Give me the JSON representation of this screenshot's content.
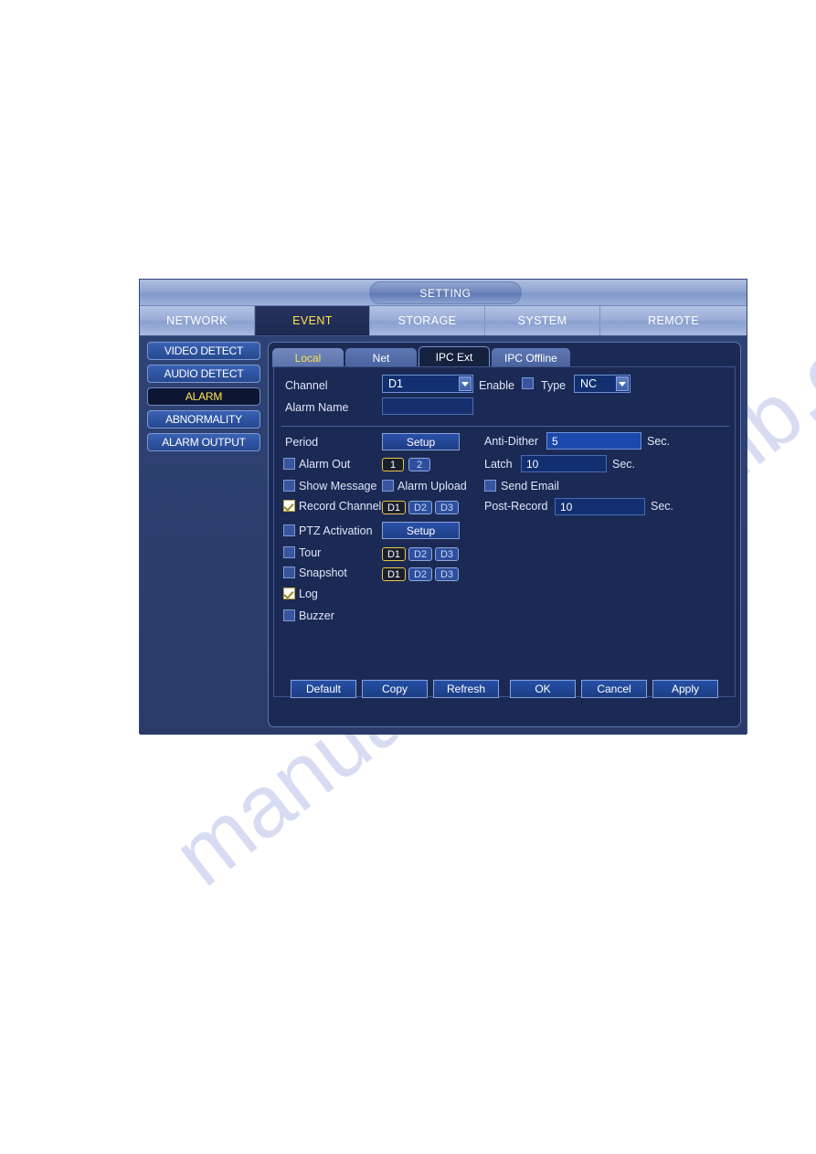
{
  "window": {
    "title": "SETTING"
  },
  "nav": {
    "tabs": [
      {
        "label": "NETWORK",
        "active": false
      },
      {
        "label": "EVENT",
        "active": true
      },
      {
        "label": "STORAGE",
        "active": false
      },
      {
        "label": "SYSTEM",
        "active": false
      },
      {
        "label": "REMOTE",
        "active": false
      }
    ]
  },
  "sidebar": {
    "items": [
      {
        "label": "VIDEO DETECT",
        "active": false
      },
      {
        "label": "AUDIO DETECT",
        "active": false
      },
      {
        "label": "ALARM",
        "active": true
      },
      {
        "label": "ABNORMALITY",
        "active": false
      },
      {
        "label": "ALARM OUTPUT",
        "active": false
      }
    ]
  },
  "subtabs": [
    {
      "label": "Local",
      "state": "highlight"
    },
    {
      "label": "Net",
      "state": "normal"
    },
    {
      "label": "IPC Ext",
      "state": "active"
    },
    {
      "label": "IPC Offline",
      "state": "normal"
    }
  ],
  "form": {
    "channel_label": "Channel",
    "channel_value": "D1",
    "enable_label": "Enable",
    "enable_checked": false,
    "type_label": "Type",
    "type_value": "NC",
    "alarm_name_label": "Alarm Name",
    "alarm_name_value": "",
    "period_label": "Period",
    "period_setup_label": "Setup",
    "anti_dither_label": "Anti-Dither",
    "anti_dither_value": "5",
    "anti_dither_unit": "Sec.",
    "alarm_out_label": "Alarm Out",
    "alarm_out_checked": false,
    "alarm_out_ports": [
      {
        "label": "1",
        "on": true
      },
      {
        "label": "2",
        "on": false
      }
    ],
    "latch_label": "Latch",
    "latch_value": "10",
    "latch_unit": "Sec.",
    "show_message_label": "Show Message",
    "show_message_checked": false,
    "alarm_upload_label": "Alarm Upload",
    "alarm_upload_checked": false,
    "send_email_label": "Send Email",
    "send_email_checked": false,
    "record_channel_label": "Record Channel",
    "record_channel_checked": true,
    "record_channels": [
      {
        "label": "D1",
        "on": true
      },
      {
        "label": "D2",
        "on": false
      },
      {
        "label": "D3",
        "on": false
      }
    ],
    "post_record_label": "Post-Record",
    "post_record_value": "10",
    "post_record_unit": "Sec.",
    "ptz_activation_label": "PTZ Activation",
    "ptz_activation_checked": false,
    "ptz_setup_label": "Setup",
    "tour_label": "Tour",
    "tour_checked": false,
    "tour_channels": [
      {
        "label": "D1",
        "on": true
      },
      {
        "label": "D2",
        "on": false
      },
      {
        "label": "D3",
        "on": false
      }
    ],
    "snapshot_label": "Snapshot",
    "snapshot_checked": false,
    "snapshot_channels": [
      {
        "label": "D1",
        "on": true
      },
      {
        "label": "D2",
        "on": false
      },
      {
        "label": "D3",
        "on": false
      }
    ],
    "log_label": "Log",
    "log_checked": true,
    "buzzer_label": "Buzzer",
    "buzzer_checked": false
  },
  "footer": {
    "buttons": [
      {
        "label": "Default"
      },
      {
        "label": "Copy"
      },
      {
        "label": "Refresh"
      },
      {
        "label": "OK"
      },
      {
        "label": "Cancel"
      },
      {
        "label": "Apply"
      }
    ]
  },
  "watermark": {
    "text": "manualslib.com"
  },
  "colors": {
    "accent_yellow": "#ffe44d",
    "panel_bg": "#1b2a55",
    "window_bg": "#2b3f6e",
    "chip_on_border": "#e8c547"
  }
}
